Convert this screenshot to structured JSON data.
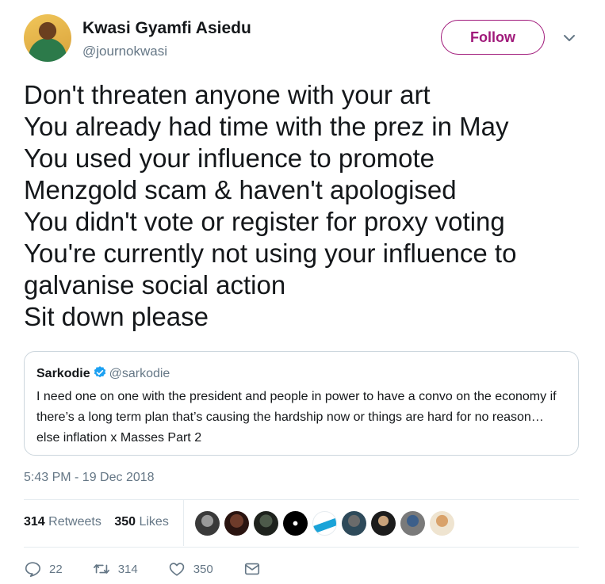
{
  "author": {
    "name": "Kwasi Gyamfi Asiedu",
    "handle": "@journokwasi",
    "follow_label": "Follow"
  },
  "tweet": {
    "text": "Don't threaten anyone with your art\nYou already had time with the prez in May\nYou used your influence to promote\nMenzgold scam & haven't apologised\nYou didn't vote or register for proxy voting\nYou're currently not using your influence to\ngalvanise social action\nSit down please",
    "timestamp": "5:43 PM - 19 Dec 2018"
  },
  "quoted_tweet": {
    "name": "Sarkodie",
    "handle": "@sarkodie",
    "text": "I need one on one with the president and people in power to have a convo on the economy if there’s a long term plan that’s causing the hardship now or things are hard for no reason… else inflation x Masses Part 2"
  },
  "stats": {
    "retweets_count": "314",
    "retweets_label": "Retweets",
    "likes_count": "350",
    "likes_label": "Likes"
  },
  "actions": {
    "replies": "22",
    "retweets": "314",
    "likes": "350"
  },
  "colors": {
    "accent": "#a0197a",
    "verified": "#1da1f2",
    "muted": "#657786"
  },
  "icons": [
    "chevron-down-icon",
    "verified-badge-icon",
    "reply-icon",
    "retweet-icon",
    "like-icon",
    "message-icon"
  ]
}
